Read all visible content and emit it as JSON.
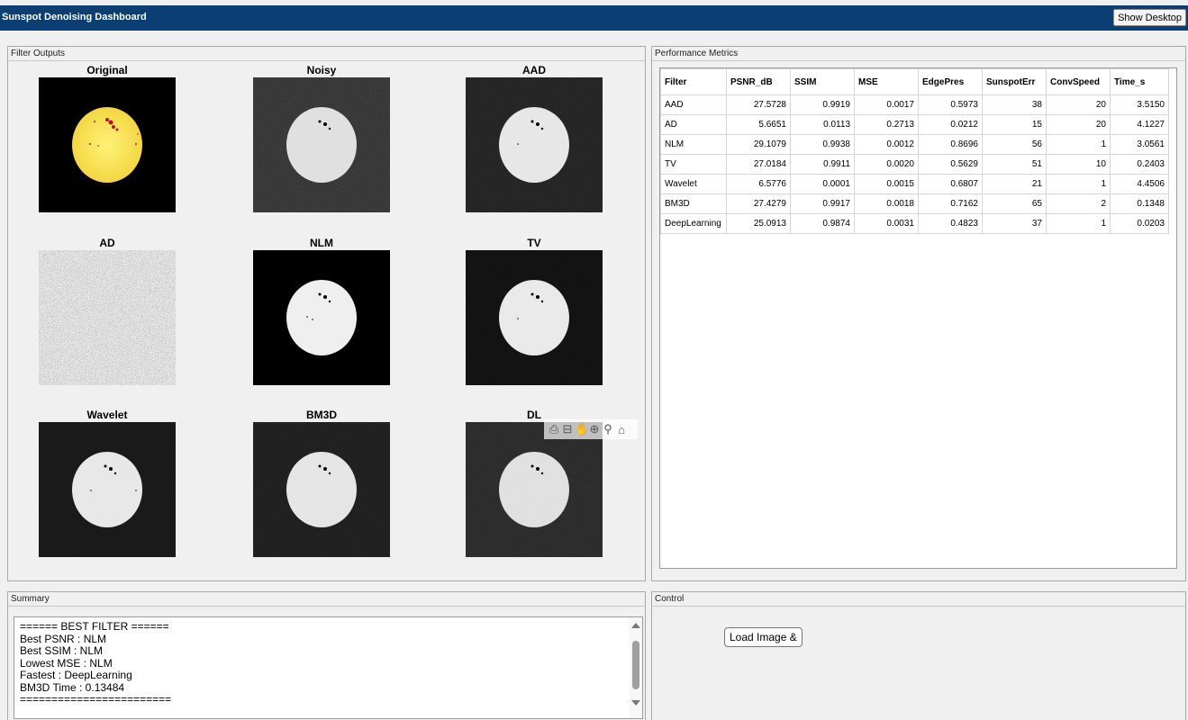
{
  "app": {
    "title": "Sunspot Denoising Dashboard",
    "show_desktop": "Show Desktop"
  },
  "filter_outputs": {
    "title": "Filter Outputs",
    "axes": [
      {
        "label": "Original"
      },
      {
        "label": "Noisy"
      },
      {
        "label": "AAD"
      },
      {
        "label": "AD"
      },
      {
        "label": "NLM"
      },
      {
        "label": "TV"
      },
      {
        "label": "Wavelet"
      },
      {
        "label": "BM3D"
      },
      {
        "label": "DL"
      }
    ],
    "axes_toolbar": [
      "export-icon",
      "datatip-icon",
      "pan-icon",
      "zoom-in-icon",
      "zoom-out-icon",
      "home-icon"
    ]
  },
  "metrics": {
    "title": "Performance Metrics",
    "columns": [
      "Filter",
      "PSNR_dB",
      "SSIM",
      "MSE",
      "EdgePres",
      "SunspotErr",
      "ConvSpeed",
      "Time_s"
    ],
    "rows": [
      [
        "AAD",
        "27.5728",
        "0.9919",
        "0.0017",
        "0.5973",
        "38",
        "20",
        "3.5150"
      ],
      [
        "AD",
        "5.6651",
        "0.0113",
        "0.2713",
        "0.0212",
        "15",
        "20",
        "4.1227"
      ],
      [
        "NLM",
        "29.1079",
        "0.9938",
        "0.0012",
        "0.8696",
        "56",
        "1",
        "3.0561"
      ],
      [
        "TV",
        "27.0184",
        "0.9911",
        "0.0020",
        "0.5629",
        "51",
        "10",
        "0.2403"
      ],
      [
        "Wavelet",
        "6.5776",
        "0.0001",
        "0.0015",
        "0.6807",
        "21",
        "1",
        "4.4506"
      ],
      [
        "BM3D",
        "27.4279",
        "0.9917",
        "0.0018",
        "0.7162",
        "65",
        "2",
        "0.1348"
      ],
      [
        "DeepLearning",
        "25.0913",
        "0.9874",
        "0.0031",
        "0.4823",
        "37",
        "1",
        "0.0203"
      ]
    ]
  },
  "summary": {
    "title": "Summary",
    "text": "====== BEST FILTER ======\nBest PSNR : NLM\nBest SSIM : NLM\nLowest MSE : NLM\nFastest : DeepLearning\nBM3D Time : 0.13484\n========================"
  },
  "control": {
    "title": "Control",
    "load_button": "Load Image &"
  }
}
